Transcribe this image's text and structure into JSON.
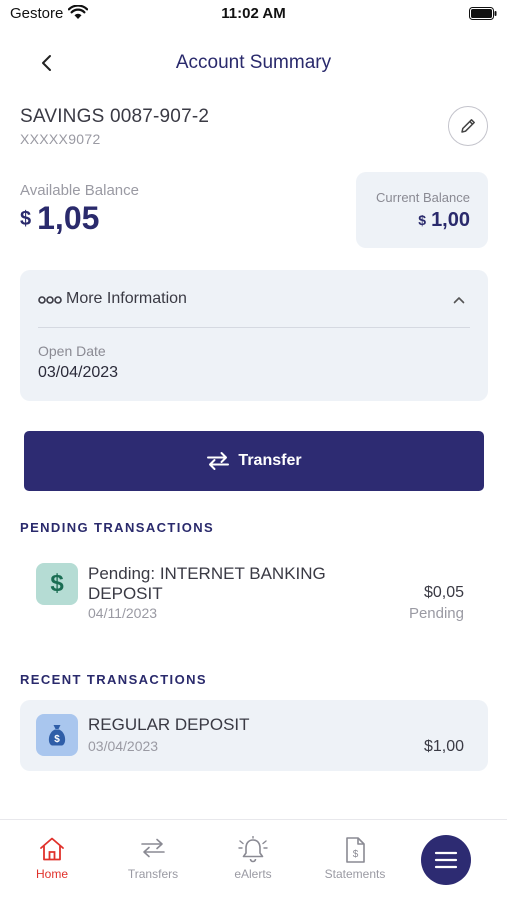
{
  "status_bar": {
    "carrier": "Gestore",
    "time": "11:02 AM"
  },
  "nav": {
    "title": "Account Summary",
    "back_icon": "chevron-left-icon"
  },
  "account": {
    "name": "SAVINGS 0087-907-2",
    "masked_number": "XXXXX9072",
    "edit_icon": "pencil-icon"
  },
  "balances": {
    "available_label": "Available Balance",
    "available_currency": "$",
    "available_value": "1,05",
    "current_label": "Current Balance",
    "current_currency": "$",
    "current_value": "1,00"
  },
  "more_info": {
    "title": "More Information",
    "open_date_label": "Open Date",
    "open_date_value": "03/04/2023",
    "expanded": true
  },
  "transfer_button": {
    "label": "Transfer",
    "icon": "transfer-arrows-icon"
  },
  "pending": {
    "section_title": "PENDING TRANSACTIONS",
    "items": [
      {
        "description": "Pending: INTERNET BANKING DEPOSIT",
        "date": "04/11/2023",
        "amount": "$0,05",
        "status": "Pending",
        "icon": "dollar-icon"
      }
    ]
  },
  "recent": {
    "section_title": "RECENT TRANSACTIONS",
    "items": [
      {
        "description": "REGULAR DEPOSIT",
        "date": "03/04/2023",
        "amount": "$1,00",
        "icon": "money-bag-icon"
      }
    ]
  },
  "tab_bar": {
    "tabs": [
      {
        "label": "Home",
        "icon": "home-icon",
        "active": true
      },
      {
        "label": "Transfers",
        "icon": "transfers-icon",
        "active": false
      },
      {
        "label": "eAlerts",
        "icon": "bell-icon",
        "active": false
      },
      {
        "label": "Statements",
        "icon": "statement-icon",
        "active": false
      }
    ],
    "menu_icon": "hamburger-menu-icon"
  },
  "colors": {
    "primary": "#2d2b72",
    "active_tab": "#e0312b",
    "card_background": "#eef2f7",
    "pending_icon_bg": "#b5dcd4",
    "recent_icon_bg": "#a9c6ee"
  }
}
